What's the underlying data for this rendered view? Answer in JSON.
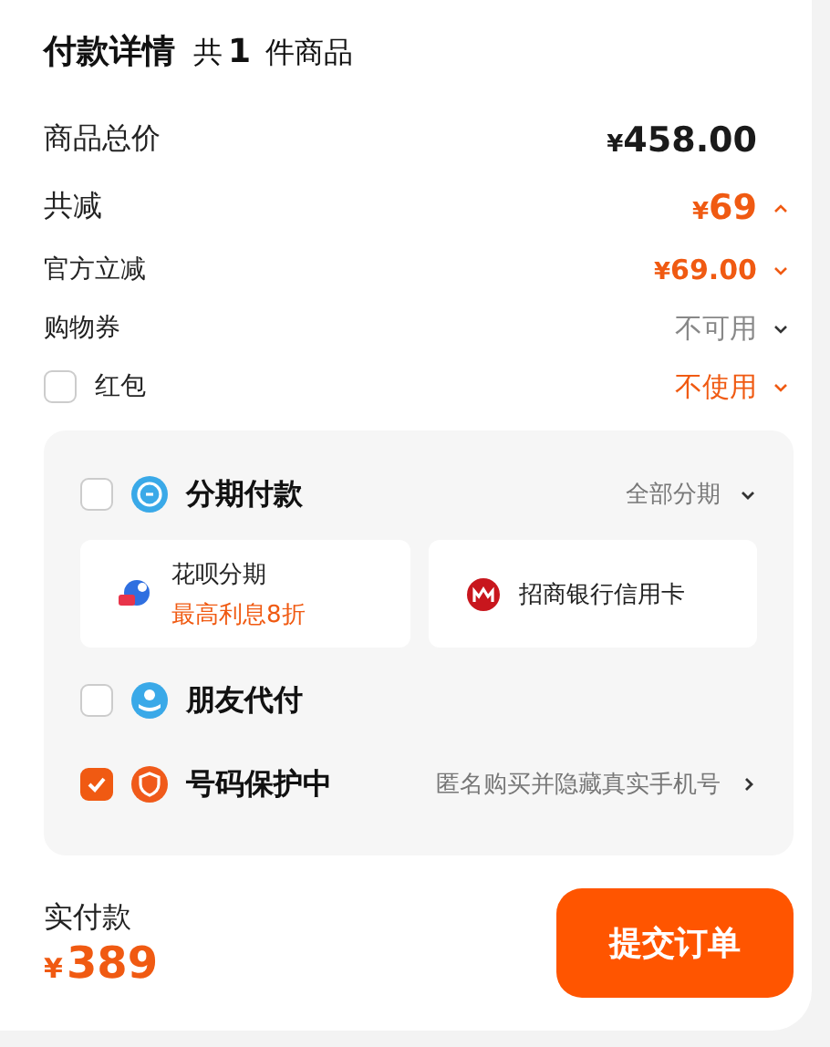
{
  "header": {
    "title": "付款详情",
    "count_prefix": "共",
    "count": "1",
    "count_suffix": "件商品"
  },
  "summary": [
    {
      "kind": "total",
      "label": "商品总价",
      "currency": "¥",
      "amount": "458.00"
    },
    {
      "kind": "reduction",
      "label": "共减",
      "currency": "¥",
      "amount": "69",
      "expanded": true
    },
    {
      "kind": "discount",
      "label": "官方立减",
      "currency": "¥",
      "amount": "69.00",
      "expanded": false
    },
    {
      "kind": "coupon",
      "label": "购物券",
      "amount": "不可用",
      "expanded": false
    },
    {
      "kind": "packet",
      "label": "红包",
      "amount": "不使用",
      "expanded": false,
      "checked": false
    }
  ],
  "payment": [
    {
      "kind": "installment",
      "title": "分期付款",
      "checked": false,
      "right": "全部分期",
      "expanded": false,
      "cards": [
        {
          "kind": "huabei",
          "title": "花呗分期",
          "subtitle": "最高利息8折"
        },
        {
          "kind": "bank",
          "title": "招商银行信用卡"
        }
      ]
    },
    {
      "kind": "friend",
      "title": "朋友代付",
      "checked": false
    },
    {
      "kind": "protect",
      "title": "号码保护中",
      "checked": true,
      "right": "匿名购买并隐藏真实手机号"
    }
  ],
  "footer": {
    "label": "实付款",
    "currency": "¥",
    "amount": "389",
    "button": "提交订单"
  }
}
